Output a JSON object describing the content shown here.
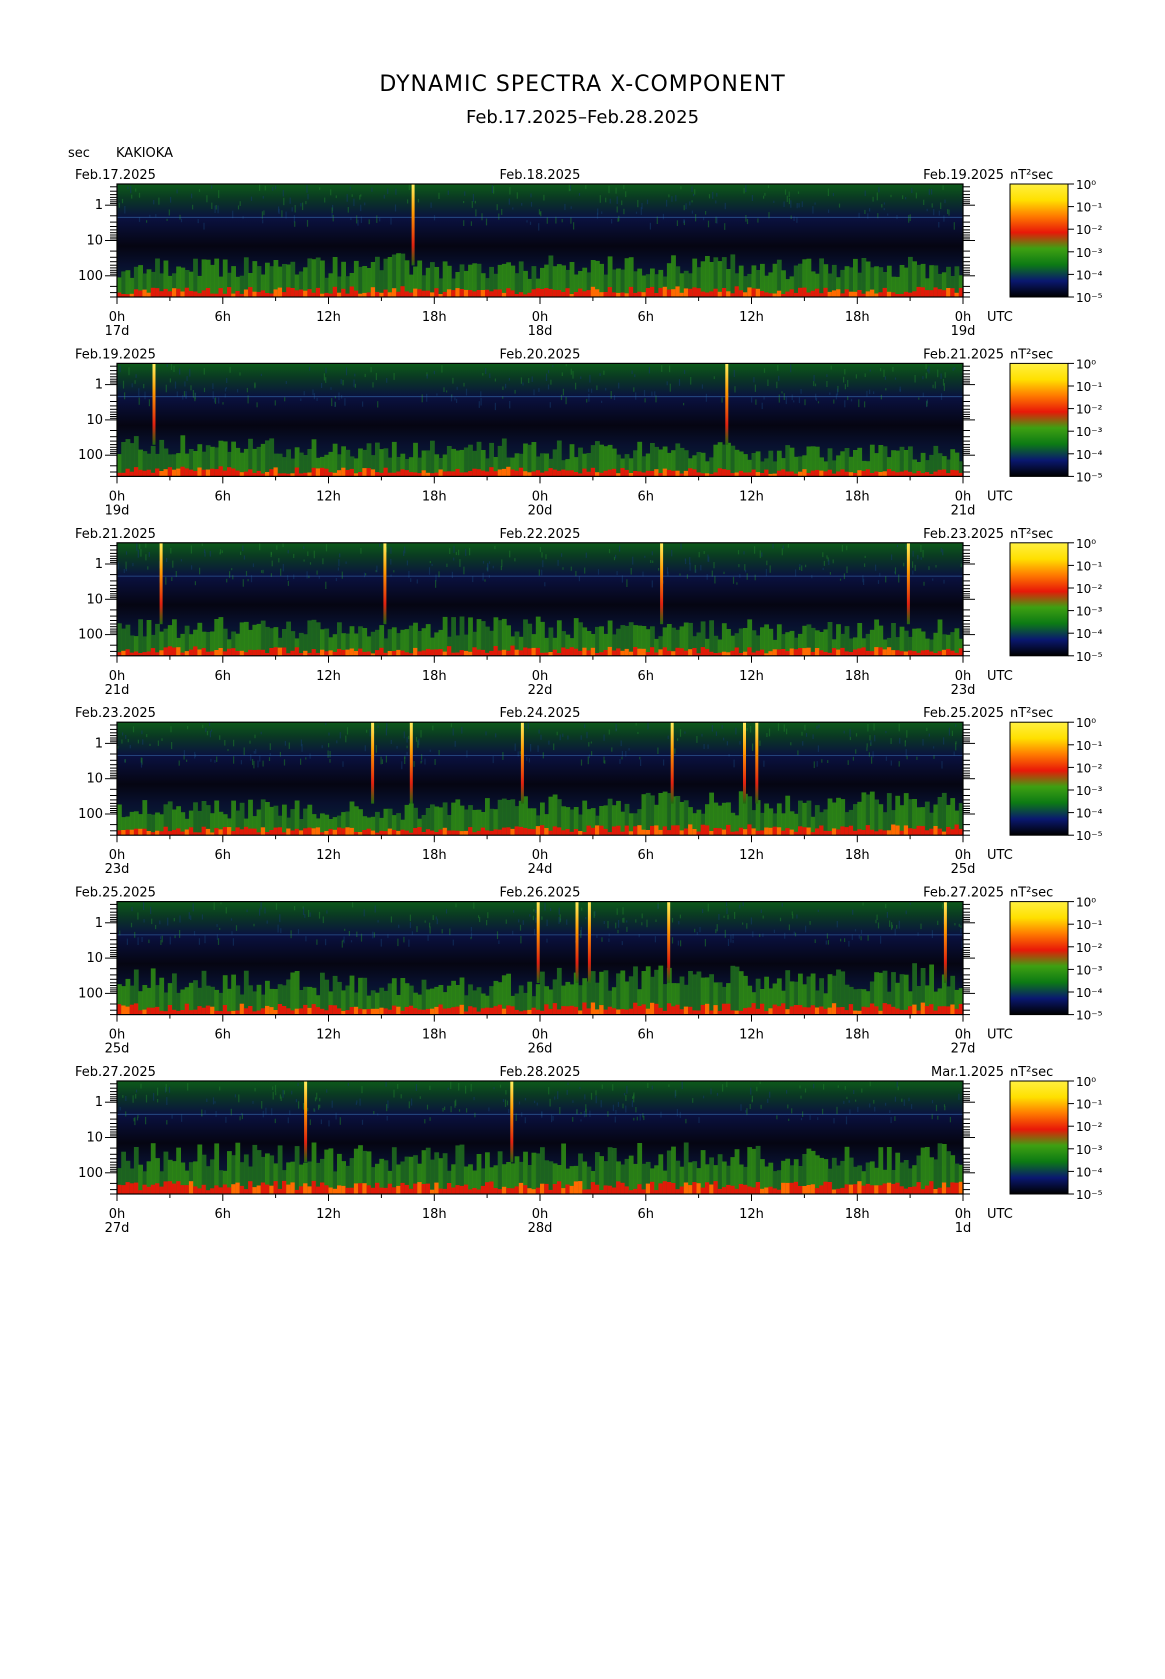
{
  "title": "DYNAMIC SPECTRA X-COMPONENT",
  "subtitle": "Feb.17.2025–Feb.28.2025",
  "station": "KAKIOKA",
  "colors": {
    "background": "#000000",
    "colorbar": [
      "#000000",
      "#0a1870",
      "#0c7a14",
      "#3ea012",
      "#e81808",
      "#ff7a00",
      "#ffe000",
      "#fff040"
    ],
    "grid_line": "#3a6fb0"
  },
  "chart_data": {
    "type": "heatmap",
    "y_axis": {
      "label": "sec",
      "scale": "log",
      "ticks": [
        "1",
        "10",
        "100"
      ],
      "range": [
        0.25,
        400
      ]
    },
    "x_axis": {
      "tick_labels": [
        "0h",
        "6h",
        "12h",
        "18h",
        "0h",
        "6h",
        "12h",
        "18h",
        "0h"
      ],
      "utc_label": "UTC",
      "span_hours": 48
    },
    "colorbar": {
      "label": "nT²sec",
      "scale": "log",
      "ticks": [
        "10⁰",
        "10⁻¹",
        "10⁻²",
        "10⁻³",
        "10⁻⁴",
        "10⁻⁵"
      ]
    },
    "panels": [
      {
        "start_date": "Feb.17.2025",
        "mid_date": "Feb.18.2025",
        "end_date": "Feb.19.2025",
        "day_labels": [
          "17d",
          "18d",
          "19d"
        ],
        "spikes_hours": [
          16.8
        ],
        "activity": [
          0.45,
          0.5,
          0.55,
          0.4,
          0.5,
          0.55,
          0.45,
          0.5
        ]
      },
      {
        "start_date": "Feb.19.2025",
        "mid_date": "Feb.20.2025",
        "end_date": "Feb.21.2025",
        "day_labels": [
          "19d",
          "20d",
          "21d"
        ],
        "spikes_hours": [
          2.1,
          34.6
        ],
        "activity": [
          0.5,
          0.45,
          0.4,
          0.45,
          0.4,
          0.35,
          0.3,
          0.3
        ]
      },
      {
        "start_date": "Feb.21.2025",
        "mid_date": "Feb.22.2025",
        "end_date": "Feb.23.2025",
        "day_labels": [
          "21d",
          "22d",
          "23d"
        ],
        "spikes_hours": [
          2.5,
          15.2,
          30.9,
          44.9
        ],
        "activity": [
          0.45,
          0.4,
          0.35,
          0.5,
          0.45,
          0.4,
          0.35,
          0.4
        ]
      },
      {
        "start_date": "Feb.23.2025",
        "mid_date": "Feb.24.2025",
        "end_date": "Feb.25.2025",
        "day_labels": [
          "23d",
          "24d",
          "25d"
        ],
        "spikes_hours": [
          14.5,
          16.7,
          23.0,
          31.5,
          35.6,
          36.3
        ],
        "activity": [
          0.4,
          0.4,
          0.35,
          0.45,
          0.5,
          0.55,
          0.5,
          0.55
        ]
      },
      {
        "start_date": "Feb.25.2025",
        "mid_date": "Feb.26.2025",
        "end_date": "Feb.27.2025",
        "day_labels": [
          "25d",
          "26d",
          "27d"
        ],
        "spikes_hours": [
          23.9,
          26.1,
          26.8,
          31.3,
          47.0
        ],
        "activity": [
          0.6,
          0.55,
          0.45,
          0.5,
          0.65,
          0.65,
          0.6,
          0.7
        ]
      },
      {
        "start_date": "Feb.27.2025",
        "mid_date": "Feb.28.2025",
        "end_date": "Mar.1.2025",
        "day_labels": [
          "27d",
          "28d",
          "1d"
        ],
        "spikes_hours": [
          10.7,
          22.4
        ],
        "activity": [
          0.7,
          0.7,
          0.65,
          0.7,
          0.7,
          0.7,
          0.65,
          0.7
        ]
      }
    ]
  }
}
